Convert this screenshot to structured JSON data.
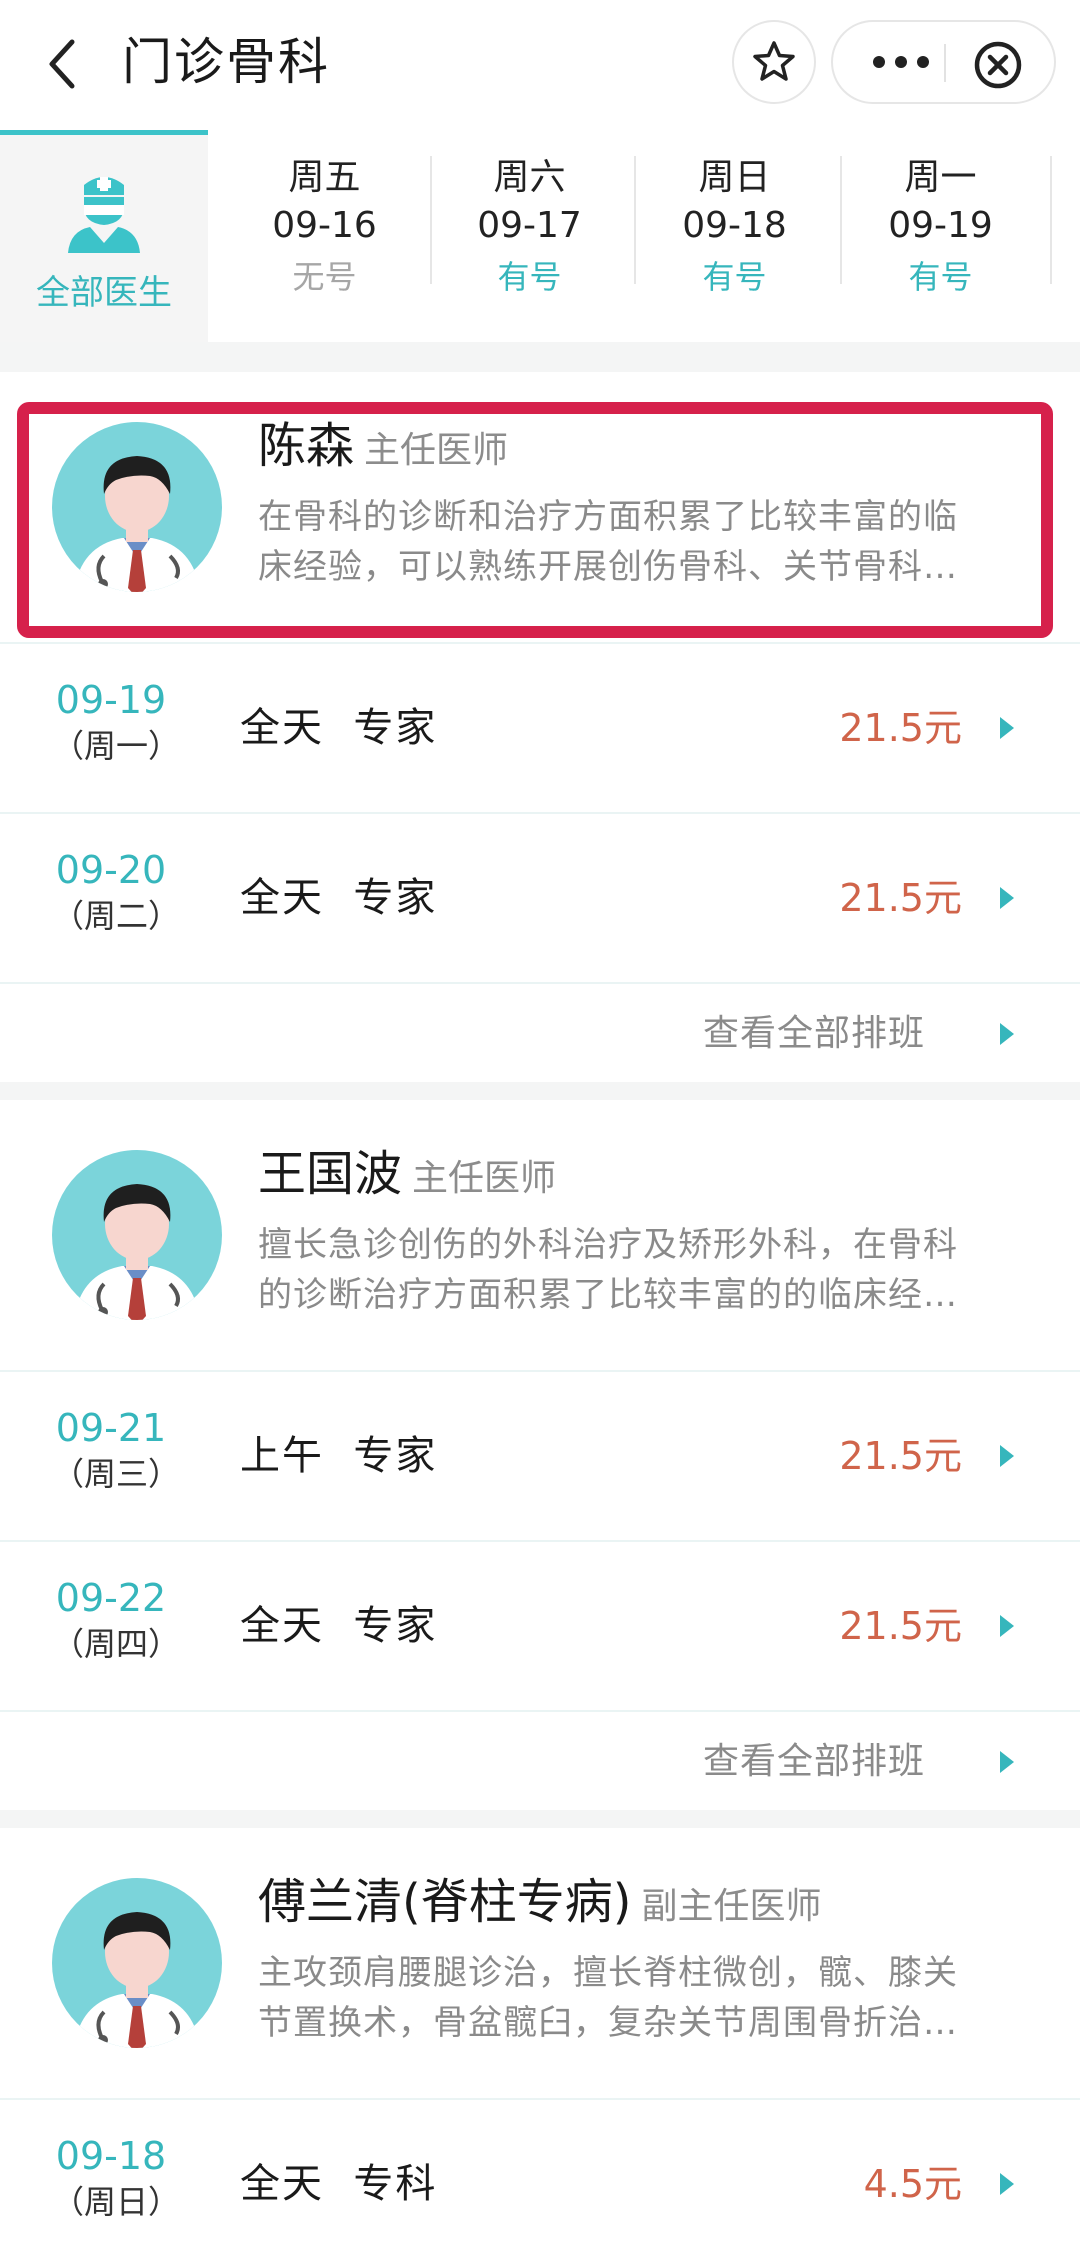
{
  "header": {
    "title": "门诊骨科",
    "icons": [
      "back-arrow-icon",
      "star-icon",
      "more-icon",
      "close-circle-icon"
    ]
  },
  "tabs": {
    "all_doctors_label": "全部医生",
    "days": [
      {
        "weekday": "周五",
        "date": "09-16",
        "status": "无号",
        "available": false
      },
      {
        "weekday": "周六",
        "date": "09-17",
        "status": "有号",
        "available": true
      },
      {
        "weekday": "周日",
        "date": "09-18",
        "status": "有号",
        "available": true
      },
      {
        "weekday": "周一",
        "date": "09-19",
        "status": "有号",
        "available": true
      }
    ]
  },
  "doctors": [
    {
      "name": "陈森",
      "title": "主任医师",
      "desc_line1": "在骨科的诊断和治疗方面积累了比较丰富的临",
      "desc_line2": "床经验，可以熟练开展创伤骨科、关节骨科…",
      "slots": [
        {
          "date": "09-19",
          "weekday": "（周一）",
          "info": "全天  专家",
          "price": "21.5元"
        },
        {
          "date": "09-20",
          "weekday": "（周二）",
          "info": "全天  专家",
          "price": "21.5元"
        }
      ],
      "view_all": "查看全部排班"
    },
    {
      "name": "王国波",
      "title": "主任医师",
      "desc_line1": "擅长急诊创伤的外科治疗及矫形外科，在骨科",
      "desc_line2": "的诊断治疗方面积累了比较丰富的的临床经…",
      "slots": [
        {
          "date": "09-21",
          "weekday": "（周三）",
          "info": "上午  专家",
          "price": "21.5元"
        },
        {
          "date": "09-22",
          "weekday": "（周四）",
          "info": "全天  专家",
          "price": "21.5元"
        }
      ],
      "view_all": "查看全部排班"
    },
    {
      "name": "傅兰清(脊柱专病)",
      "title": "副主任医师",
      "desc_line1": "主攻颈肩腰腿诊治，擅长脊柱微创，髋、膝关",
      "desc_line2": "节置换术，骨盆髋臼，复杂关节周围骨折治…",
      "slots": [
        {
          "date": "09-18",
          "weekday": "（周日）",
          "info": "全天  专科",
          "price": "4.5元"
        }
      ]
    }
  ],
  "colors": {
    "accent": "#36b6bc",
    "price": "#d0644a",
    "highlight": "#d6214b",
    "muted": "#8a8a8a"
  }
}
